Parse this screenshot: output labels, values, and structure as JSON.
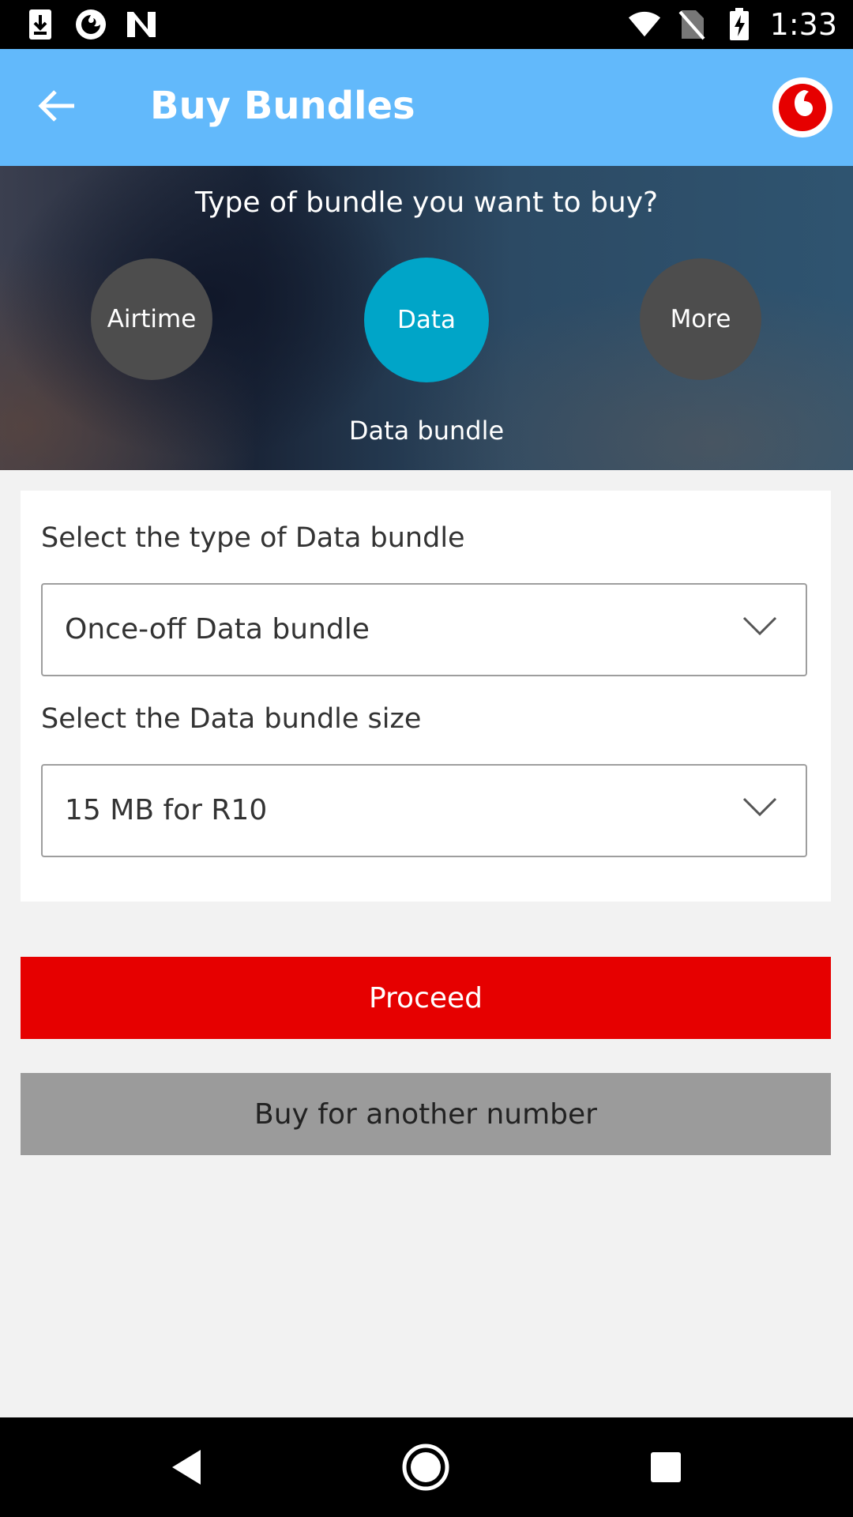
{
  "status_bar": {
    "time": "1:33",
    "left_icons": [
      "download-icon",
      "firefox-icon",
      "n-icon"
    ],
    "right_icons": [
      "wifi-icon",
      "no-sim-icon",
      "battery-charging-icon"
    ]
  },
  "app_bar": {
    "title": "Buy Bundles",
    "back_icon": "arrow-left-icon",
    "logo": "vodafone-logo"
  },
  "bundle_type": {
    "question": "Type of bundle you want to buy?",
    "options": [
      {
        "label": "Airtime",
        "selected": false
      },
      {
        "label": "Data",
        "selected": true
      },
      {
        "label": "More",
        "selected": false
      }
    ],
    "caption": "Data bundle"
  },
  "form": {
    "type_label": "Select the type of Data bundle",
    "type_value": "Once-off Data bundle",
    "size_label": "Select the Data bundle size",
    "size_value": "15 MB for R10"
  },
  "actions": {
    "proceed_label": "Proceed",
    "other_number_label": "Buy for another number"
  },
  "colors": {
    "app_bar": "#62b9fb",
    "selected_option": "#00a5c8",
    "unselected_option": "#4d4d4d",
    "primary_button": "#e60000",
    "secondary_button": "#9b9b9b"
  },
  "nav_bar": {
    "buttons": [
      "back-triangle-icon",
      "home-circle-icon",
      "recents-square-icon"
    ]
  }
}
